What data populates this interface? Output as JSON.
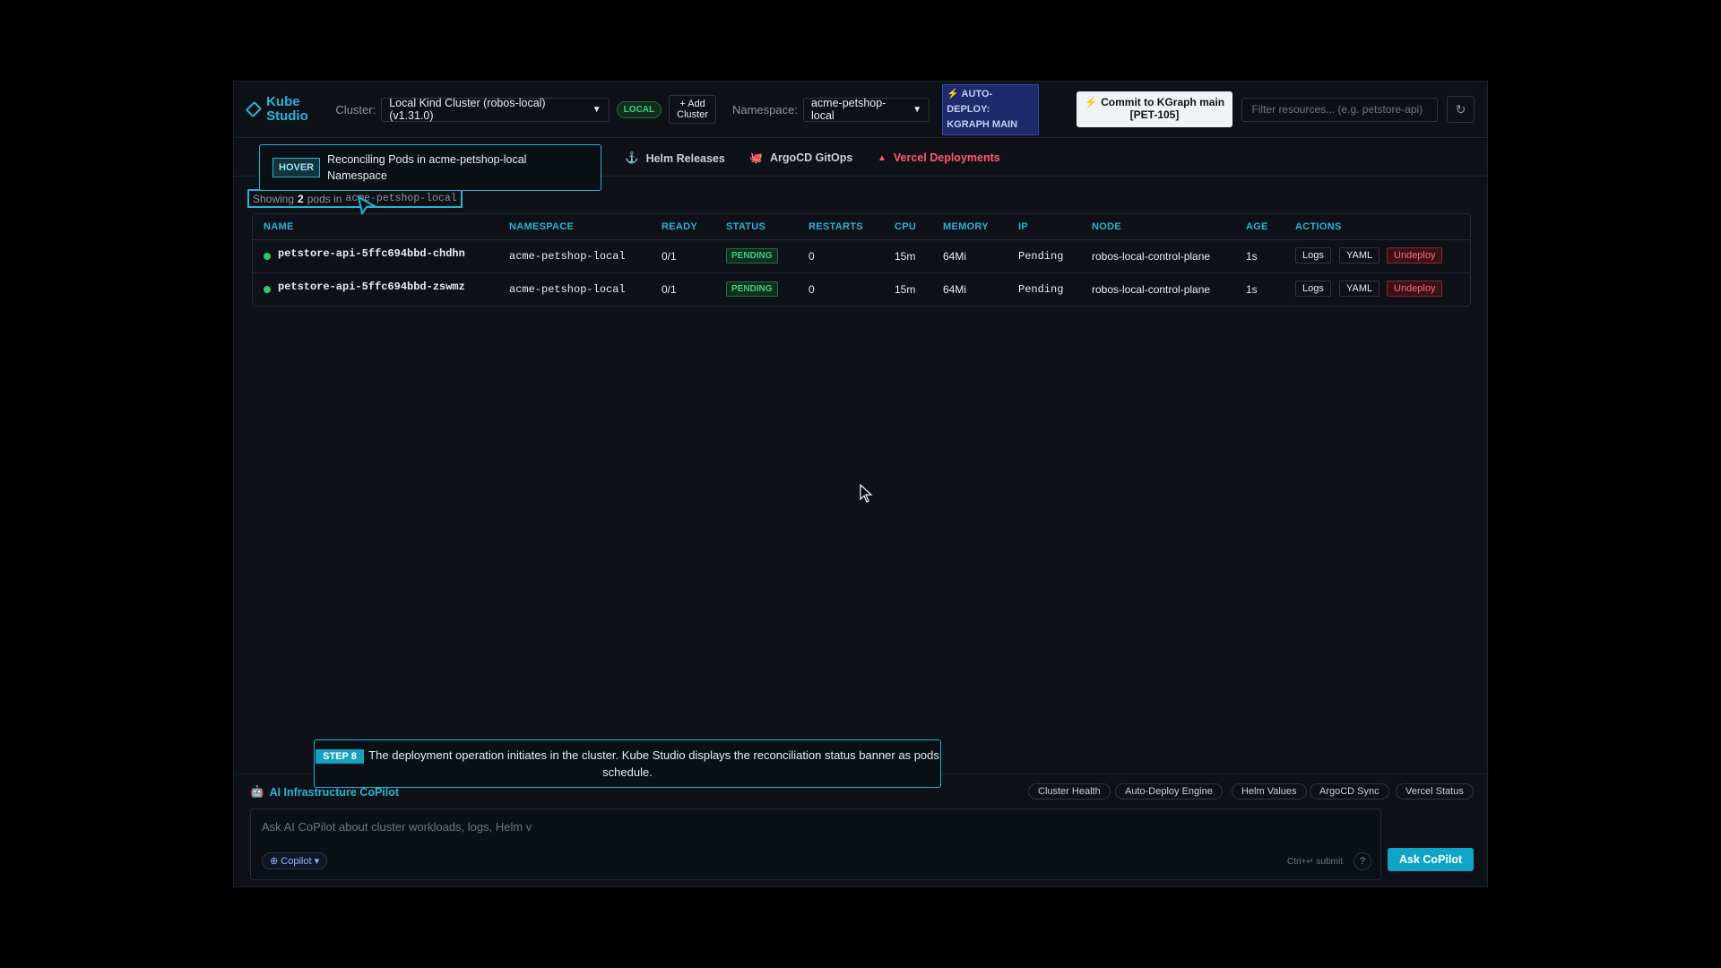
{
  "header": {
    "logo_text": "Kube Studio",
    "cluster_label": "Cluster:",
    "cluster_value": "Local Kind Cluster (robos-local) (v1.31.0)",
    "cluster_badge": "LOCAL",
    "add_cluster": "+ Add Cluster",
    "namespace_label": "Namespace:",
    "namespace_value": "acme-petshop-local",
    "auto_deploy": "⚡ AUTO-DEPLOY: KGRAPH MAIN",
    "commit_button": "⚡ Commit to KGraph main [PET-105]",
    "filter_placeholder": "Filter resources... (e.g. petstore-api)",
    "refresh_icon": "↻"
  },
  "tabs": [
    {
      "label": "Helm Releases",
      "icon": "⚓",
      "color": "#c9d1d9"
    },
    {
      "label": "ArgoCD GitOps",
      "icon": "🐙",
      "color": "#c9d1d9"
    },
    {
      "label": "Vercel Deployments",
      "icon": "▲",
      "color": "#ff5b6e"
    }
  ],
  "hover_overlay": {
    "tag": "HOVER",
    "text": "Reconciling Pods in acme-petshop-local Namespace"
  },
  "showing": {
    "prefix": "Showing",
    "count": "2",
    "middle": "pods in",
    "namespace": "acme-petshop-local"
  },
  "table": {
    "columns": [
      "NAME",
      "NAMESPACE",
      "READY",
      "STATUS",
      "RESTARTS",
      "CPU",
      "MEMORY",
      "IP",
      "NODE",
      "AGE",
      "ACTIONS"
    ],
    "rows": [
      {
        "name": "petstore-api-5ffc694bbd-chdhn",
        "namespace": "acme-petshop-local",
        "ready": "0/1",
        "status": "PENDING",
        "restarts": "0",
        "cpu": "15m",
        "memory": "64Mi",
        "ip": "Pending",
        "node": "robos-local-control-plane",
        "age": "1s",
        "actions": [
          "Logs",
          "YAML",
          "Undeploy"
        ]
      },
      {
        "name": "petstore-api-5ffc694bbd-zswmz",
        "namespace": "acme-petshop-local",
        "ready": "0/1",
        "status": "PENDING",
        "restarts": "0",
        "cpu": "15m",
        "memory": "64Mi",
        "ip": "Pending",
        "node": "robos-local-control-plane",
        "age": "1s",
        "actions": [
          "Logs",
          "YAML",
          "Undeploy"
        ]
      }
    ]
  },
  "copilot": {
    "title": "AI Infrastructure CoPilot",
    "title_icon": "🤖",
    "pills": [
      "Cluster Health",
      "Auto-Deploy Engine",
      "Helm Values",
      "ArgoCD Sync",
      "Vercel Status"
    ],
    "placeholder": "Ask AI CoPilot about cluster workloads, logs, Helm v",
    "chip": "⊕ Copilot ▾",
    "hint": "Ctrl+↵ submit",
    "help": "?",
    "ask_button": "Ask CoPilot"
  },
  "step_overlay": {
    "tag": "STEP 8",
    "text": "The deployment operation initiates in the cluster. Kube Studio displays the reconciliation status banner as pods schedule."
  },
  "colors": {
    "accent": "#2bb5d6",
    "background": "#0e1117",
    "success": "#3fd07c",
    "danger": "#ff6b6b"
  }
}
